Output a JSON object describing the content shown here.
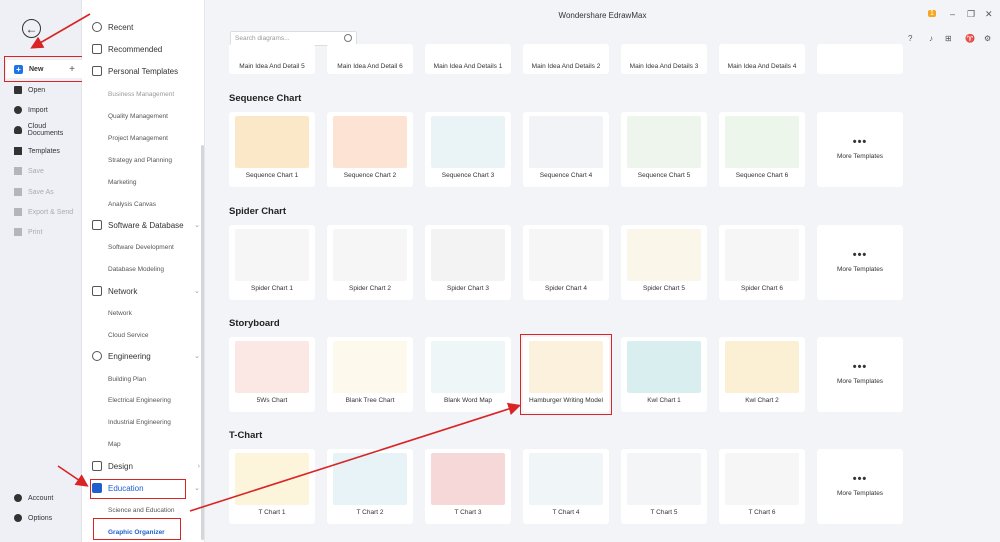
{
  "window": {
    "title": "Wondershare EdrawMax",
    "search_placeholder": "Search diagrams..."
  },
  "leftnav": {
    "new_label": "New",
    "items": [
      {
        "label": "Open",
        "disabled": false
      },
      {
        "label": "Import",
        "disabled": false
      },
      {
        "label": "Cloud Documents",
        "disabled": false
      },
      {
        "label": "Templates",
        "disabled": false
      },
      {
        "label": "Save",
        "disabled": true
      },
      {
        "label": "Save As",
        "disabled": true
      },
      {
        "label": "Export & Send",
        "disabled": true
      },
      {
        "label": "Print",
        "disabled": true
      }
    ],
    "account": "Account",
    "options": "Options"
  },
  "catnav": {
    "recent": "Recent",
    "recommended": "Recommended",
    "personal_templates": "Personal Templates",
    "business_subs": [
      "Business Management",
      "Quality Management",
      "Project Management",
      "Strategy and Planning",
      "Marketing",
      "Analysis Canvas"
    ],
    "software": "Software & Database",
    "software_subs": [
      "Software Development",
      "Database Modeling"
    ],
    "network": "Network",
    "network_subs": [
      "Network",
      "Cloud Service"
    ],
    "engineering": "Engineering",
    "engineering_subs": [
      "Building Plan",
      "Electrical Engineering",
      "Industrial Engineering",
      "Map"
    ],
    "design": "Design",
    "education": "Education",
    "education_subs": [
      "Science and Education",
      "Graphic Organizer"
    ]
  },
  "top_row": [
    "Main Idea And Detail 5",
    "Main Idea And Detail 6",
    "Main Idea And Details 1",
    "Main Idea And Details 2",
    "Main Idea And Details 3",
    "Main Idea And Details 4"
  ],
  "more_label": "More Templates",
  "more_dots": "•••",
  "sections": [
    {
      "title": "Sequence Chart",
      "cards": [
        "Sequence Chart 1",
        "Sequence Chart 2",
        "Sequence Chart 3",
        "Sequence Chart 4",
        "Sequence Chart 5",
        "Sequence Chart 6"
      ]
    },
    {
      "title": "Spider Chart",
      "cards": [
        "Spider Chart 1",
        "Spider Chart 2",
        "Spider Chart 3",
        "Spider Chart 4",
        "Spider Chart 5",
        "Spider Chart 6"
      ]
    },
    {
      "title": "Storyboard",
      "cards": [
        "5Ws Chart",
        "Blank Tree Chart",
        "Blank Word Map",
        "Hamburger Writing Model",
        "Kwl Chart 1",
        "Kwl Chart 2"
      ]
    },
    {
      "title": "T-Chart",
      "cards": [
        "T Chart 1",
        "T Chart 2",
        "T Chart 3",
        "T Chart 4",
        "T Chart 5",
        "T Chart 6"
      ]
    }
  ],
  "colors": {
    "accent": "#1e73e8",
    "highlight": "#d82424"
  },
  "badge": "1"
}
